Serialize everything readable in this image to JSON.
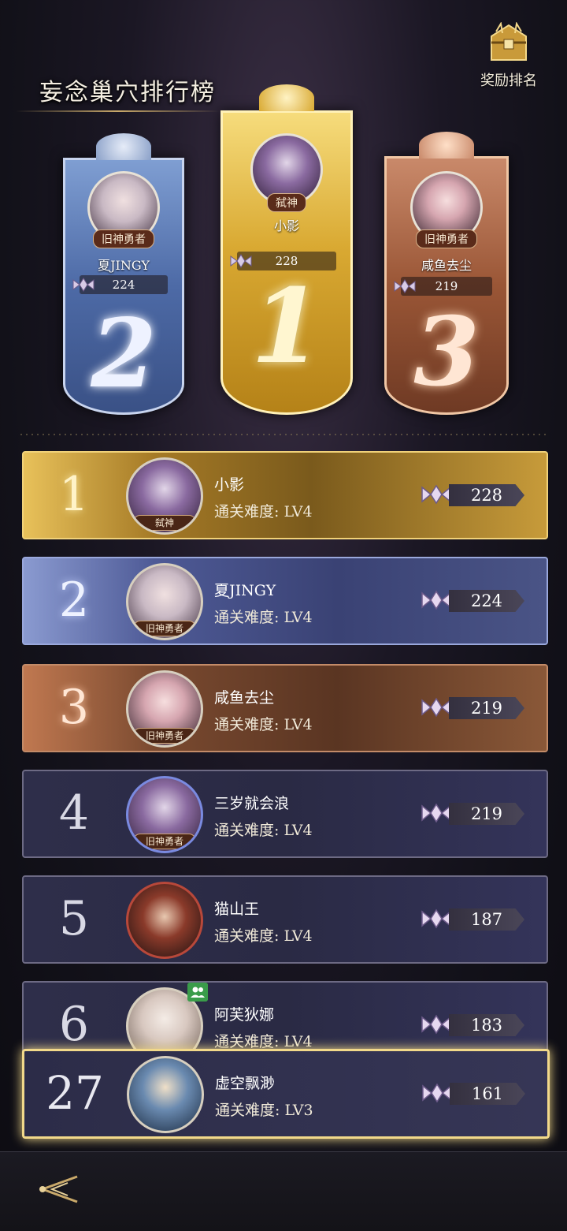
{
  "title": "妄念巢穴排行榜",
  "reward_button": {
    "label": "奖励排名"
  },
  "podium": [
    {
      "rank": "2",
      "name": "夏JINGY",
      "tag": "旧神勇者",
      "score": "224"
    },
    {
      "rank": "1",
      "name": "小影",
      "tag": "弑神",
      "score": "228"
    },
    {
      "rank": "3",
      "name": "咸鱼去尘",
      "tag": "旧神勇者",
      "score": "219"
    }
  ],
  "rows": [
    {
      "rank": "1",
      "name": "小影",
      "difficulty": "通关难度: LV4",
      "tag": "弑神",
      "score": "228"
    },
    {
      "rank": "2",
      "name": "夏JINGY",
      "difficulty": "通关难度: LV4",
      "tag": "旧神勇者",
      "score": "224"
    },
    {
      "rank": "3",
      "name": "咸鱼去尘",
      "difficulty": "通关难度: LV4",
      "tag": "旧神勇者",
      "score": "219"
    },
    {
      "rank": "4",
      "name": "三岁就会浪",
      "difficulty": "通关难度: LV4",
      "tag": "旧神勇者",
      "score": "219"
    },
    {
      "rank": "5",
      "name": "猫山王",
      "difficulty": "通关难度: LV4",
      "tag": "",
      "score": "187"
    },
    {
      "rank": "6",
      "name": "阿芙狄娜",
      "difficulty": "通关难度: LV4",
      "tag": "",
      "score": "183"
    }
  ],
  "me": {
    "rank": "27",
    "name": "虚空飘渺",
    "difficulty": "通关难度: LV3",
    "score": "161"
  },
  "icons": {
    "reward": "treasure-chest-icon",
    "score": "winged-emblem-icon",
    "friend": "friend-icon",
    "back": "back-arrow-icon"
  },
  "colors": {
    "gold": "#e9c25a",
    "silver": "#9aa8dc",
    "bronze": "#c38b68"
  }
}
